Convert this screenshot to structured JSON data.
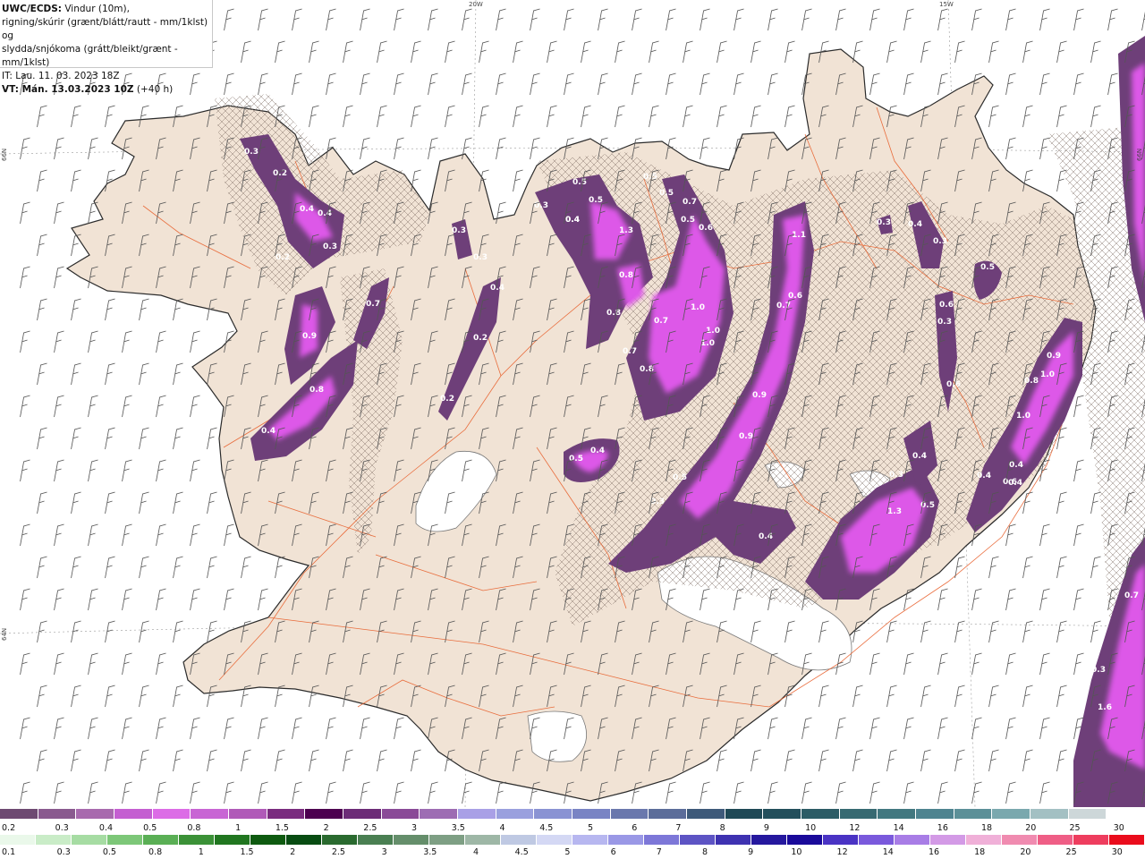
{
  "header": {
    "line1_bold": "UWC/ECDS:",
    "line1_rest": " Vindur (10m),",
    "line2": "rigning/skúrir (grænt/blátt/rautt - mm/1klst) og",
    "line3": "slydda/snjókoma (grátt/bleikt/grænt - mm/1klst)",
    "line4": "IT: Lau. 11. 03. 2023 18Z",
    "line5_bold": "VT: Mán. 13.03.2023 10Z",
    "line5_rest": " (+40 h)"
  },
  "coords": {
    "top_20w": "20W",
    "top_15w": "15W",
    "left_66n": "66N",
    "left_64n": "64N",
    "right_66n": "66N"
  },
  "colors": {
    "land": "#f1e3d5",
    "roads": "#e8602c",
    "sea": "#ffffff",
    "precip_light": "#6e3f79",
    "precip_mid": "#9b4cb0",
    "precip_strong": "#dd58e8",
    "precip_peak": "#f07cf6"
  },
  "map_labels": [
    "0.3",
    "0.2",
    "0.4",
    "0.4",
    "0.3",
    "0.2",
    "0.9",
    "0.8",
    "0.4",
    "0.7",
    "0.2",
    "0.3",
    "0.3",
    "0.2",
    "0.4",
    "0.3",
    "0.4",
    "1.3",
    "0.5",
    "0.8",
    "0.8",
    "0.4",
    "0.5",
    "0.5",
    "0.5",
    "0.7",
    "0.5",
    "0.6",
    "0.7",
    "1.0",
    "1.0",
    "1.0",
    "0.8",
    "0.7",
    "1.1",
    "0.6",
    "0.7",
    "0.9",
    "0.9",
    "0.3",
    "0.5",
    "0.4",
    "0.5",
    "0.5",
    "0.4",
    "0.4",
    "0.3",
    "0.3",
    "0.3",
    "0.6",
    "0.6",
    "1.3",
    "0.5",
    "0.3",
    "0.4",
    "0.6",
    "0.9",
    "1.0",
    "0.8",
    "1.0",
    "0.4",
    "0.4",
    "0.4",
    "0.3",
    "0.7",
    "1.6"
  ],
  "legend": {
    "snow_colors": [
      "#6e4a72",
      "#8a5a8f",
      "#a86aae",
      "#c45fd1",
      "#dc6ce6",
      "#c865d4",
      "#b05ab8",
      "#7a2c7f",
      "#4d0050",
      "#6c2c77",
      "#8a4a97",
      "#9d6cb3",
      "#a9a0e6",
      "#9aa0de",
      "#8a93d3",
      "#7984c4",
      "#6a78ad",
      "#5c6d9a",
      "#3e5a7a",
      "#1f4956",
      "#234f5c",
      "#2c5c66",
      "#376a72",
      "#427880",
      "#4e8490",
      "#5c9098",
      "#7aa8ae",
      "#a3c0c3",
      "#cdd7d9",
      "#ffffff"
    ],
    "snow_labels": [
      "0.2",
      "0.3",
      "0.4",
      "0.5",
      "0.8",
      "1",
      "1.5",
      "2",
      "2.5",
      "3",
      "3.5",
      "4",
      "4.5",
      "5",
      "6",
      "7",
      "8",
      "9",
      "10",
      "12",
      "14",
      "16",
      "18",
      "20",
      "25",
      "30"
    ],
    "rain_colors": [
      "#eaf8ea",
      "#c9ecc7",
      "#a6dca3",
      "#7dc778",
      "#5aaf55",
      "#3b9137",
      "#217620",
      "#0e5a10",
      "#084c12",
      "#2a6a2f",
      "#4a7f52",
      "#658e6b",
      "#7e9f84",
      "#9eb7a6",
      "#bfc9e3",
      "#d4d8f4",
      "#b7b7f0",
      "#9a98e6",
      "#7d77d8",
      "#5d54c4",
      "#3e32b1",
      "#25189e",
      "#1a0a9a",
      "#4a33c4",
      "#7a59dc",
      "#a87de6",
      "#d39ae6",
      "#f0b0d8",
      "#f08bb0",
      "#ef5e86",
      "#ee3d5e",
      "#ea0c1c"
    ],
    "rain_labels": [
      "0.1",
      "0.3",
      "0.5",
      "0.8",
      "1",
      "1.5",
      "2",
      "2.5",
      "3",
      "3.5",
      "4",
      "4.5",
      "5",
      "6",
      "7",
      "8",
      "9",
      "10",
      "12",
      "14",
      "16",
      "18",
      "20",
      "25",
      "30"
    ]
  }
}
